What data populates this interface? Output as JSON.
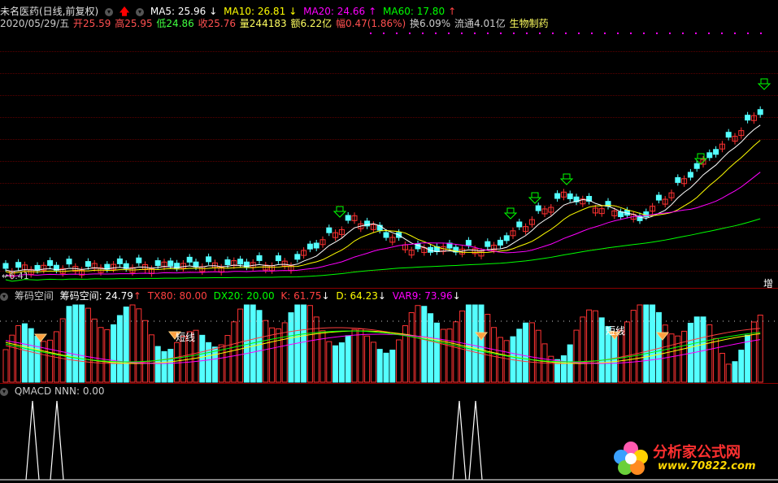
{
  "main_panel": {
    "title": "未名医药(日线,前复权)",
    "ma": [
      {
        "label": "MA5: 25.96",
        "color": "#ffffff",
        "arrow": "↓"
      },
      {
        "label": "MA10: 26.81",
        "color": "#ffff00",
        "arrow": "↓"
      },
      {
        "label": "MA20: 24.66",
        "color": "#ff00ff",
        "arrow": "↑"
      },
      {
        "label": "MA60: 17.80",
        "color": "#00ff00",
        "arrow": "↑"
      }
    ],
    "quote": {
      "date": "2020/05/29/五",
      "open": "开25.59",
      "high": "高25.95",
      "low": "低24.86",
      "close": "收25.76",
      "volume": "量244183",
      "amount": "额6.22亿",
      "change": "幅0.47(1.86%)",
      "turnover": "换6.09%",
      "float": "流通4.01亿",
      "sector": "生物制药"
    },
    "low_price_label": "6.41",
    "badge": "增"
  },
  "indicator_panel": {
    "name": "筹码空间",
    "items": [
      {
        "label": "筹码空间: 24.79",
        "color": "#ffffff",
        "arrow": "↑"
      },
      {
        "label": "TX80: 80.00",
        "color": "#ff4040",
        "arrow": ""
      },
      {
        "label": "DX20: 20.00",
        "color": "#00ff00",
        "arrow": ""
      },
      {
        "label": "K: 61.75",
        "color": "#ff4040",
        "arrow": "↓"
      },
      {
        "label": "D: 64.23",
        "color": "#ffff00",
        "arrow": "↓"
      },
      {
        "label": "VAR9: 73.96",
        "color": "#ff00ff",
        "arrow": "↓"
      }
    ],
    "annotations": [
      "短线",
      "短线"
    ]
  },
  "qmacd_panel": {
    "title": "QMACD  NNN: 0.00"
  },
  "watermark": {
    "line1": "分析家公式网",
    "line2": "www.70822.com"
  },
  "colors": {
    "up": "#ff3232",
    "down": "#54ffff",
    "ma5": "#ffffff",
    "ma10": "#ffff00",
    "ma20": "#ff00ff",
    "ma60": "#00ff00"
  }
}
